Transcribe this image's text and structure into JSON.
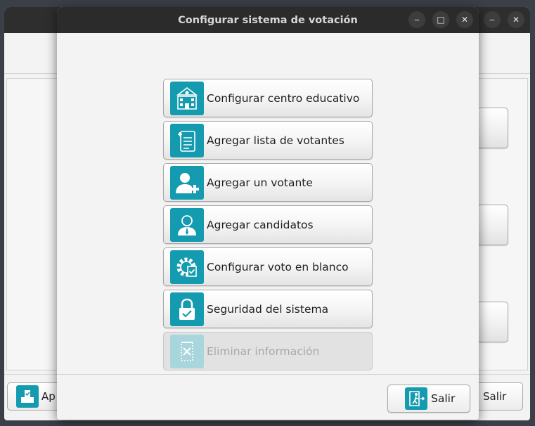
{
  "background_window": {
    "apply_label": "Ap",
    "exit_label": "Salir"
  },
  "dialog": {
    "title": "Configurar sistema de votación",
    "window_controls": {
      "minimize": "‒",
      "maximize": "□",
      "close": "✕"
    },
    "menu": [
      {
        "label": "Configurar centro educativo",
        "icon": "school-building-icon",
        "enabled": true
      },
      {
        "label": "Agregar lista de votantes",
        "icon": "add-list-icon",
        "enabled": true
      },
      {
        "label": "Agregar un votante",
        "icon": "add-user-icon",
        "enabled": true
      },
      {
        "label": "Agregar candidatos",
        "icon": "candidate-icon",
        "enabled": true
      },
      {
        "label": "Configurar voto en blanco",
        "icon": "gear-check-icon",
        "enabled": true
      },
      {
        "label": "Seguridad del sistema",
        "icon": "lock-check-icon",
        "enabled": true
      },
      {
        "label": "Eliminar información",
        "icon": "delete-document-icon",
        "enabled": false
      }
    ],
    "exit_label": "Salir"
  },
  "colors": {
    "accent": "#159bb0",
    "titlebar": "#2b2b2b"
  }
}
